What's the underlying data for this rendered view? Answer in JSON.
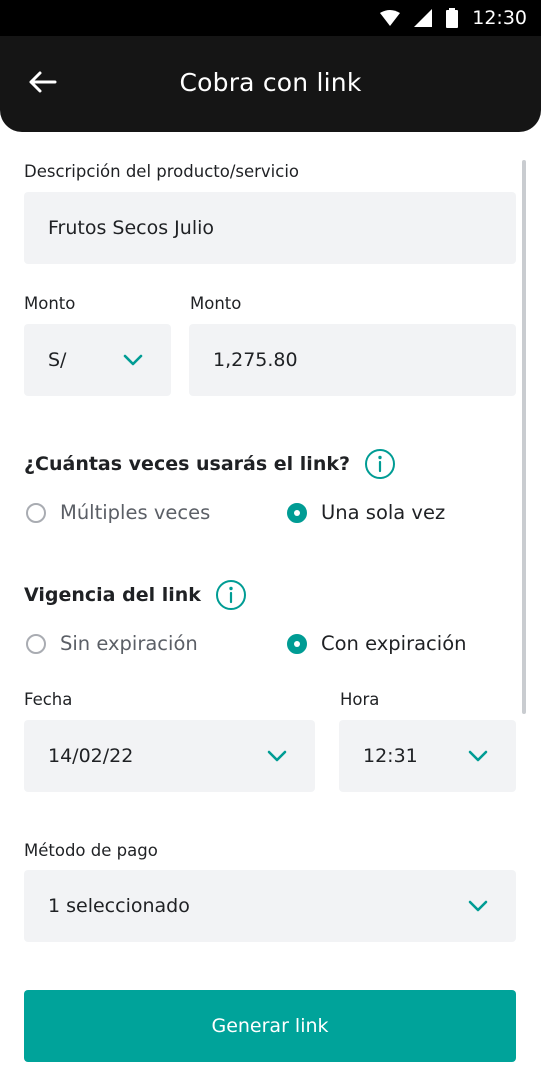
{
  "statusbar": {
    "time": "12:30",
    "icons": [
      "wifi-icon",
      "signal-icon",
      "battery-icon"
    ]
  },
  "header": {
    "title": "Cobra con link",
    "back_icon": "arrow-left-icon"
  },
  "form": {
    "description": {
      "label": "Descripción del producto/servicio",
      "value": "Frutos Secos Julio"
    },
    "currency": {
      "label": "Monto",
      "value": "S/"
    },
    "amount": {
      "label": "Monto",
      "value": "1,275.80"
    },
    "usage": {
      "title": "¿Cuántas veces usarás el link?",
      "options": [
        {
          "label": "Múltiples veces",
          "selected": false
        },
        {
          "label": "Una sola vez",
          "selected": true
        }
      ]
    },
    "validity": {
      "title": "Vigencia del link",
      "options": [
        {
          "label": "Sin expiración",
          "selected": false
        },
        {
          "label": "Con expiración",
          "selected": true
        }
      ]
    },
    "date": {
      "label": "Fecha",
      "value": "14/02/22"
    },
    "time": {
      "label": "Hora",
      "value": "12:31"
    },
    "payment_method": {
      "label": "Método de pago",
      "value": "1 seleccionado"
    }
  },
  "cta": {
    "label": "Generar link"
  },
  "colors": {
    "accent": "#00a39a",
    "header_bg": "#151515",
    "field_bg": "#f2f3f5"
  }
}
